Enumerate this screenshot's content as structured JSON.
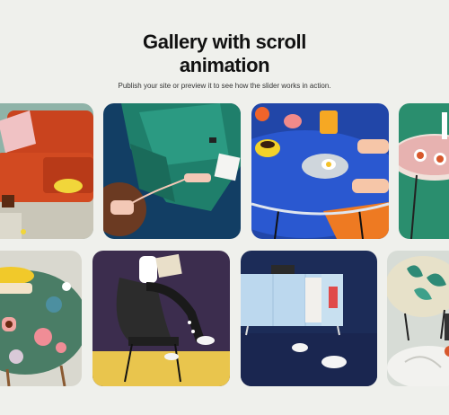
{
  "page": {
    "title": "Gallery with scroll\nanimation",
    "subtitle": "Publish your site or preview it to see how the slider works in action."
  },
  "gallery": {
    "row1": [
      {
        "name": "orange-sofa-photo"
      },
      {
        "name": "green-sofa-phone-photo"
      },
      {
        "name": "breakfast-table-photo"
      },
      {
        "name": "patterned-table-photo"
      }
    ],
    "row2": [
      {
        "name": "floral-table-photo"
      },
      {
        "name": "reading-chair-photo"
      },
      {
        "name": "blue-cabinet-photo"
      },
      {
        "name": "leaf-table-photo"
      }
    ]
  },
  "colors": {
    "background": "#eff0ec",
    "title": "#111111"
  }
}
